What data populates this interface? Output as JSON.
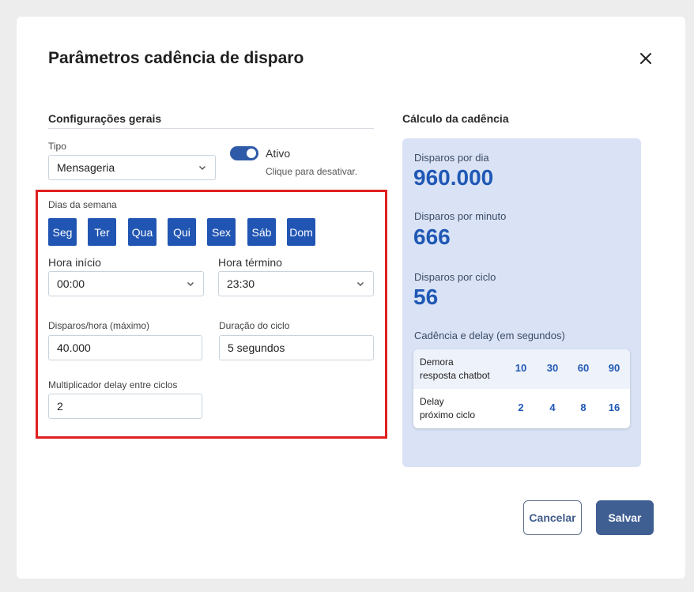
{
  "dialog": {
    "title": "Parâmetros cadência de disparo",
    "close_icon": "close-icon"
  },
  "general": {
    "heading": "Configurações gerais",
    "tipo_label": "Tipo",
    "tipo_value": "Mensageria",
    "toggle_label": "Ativo",
    "toggle_state": true,
    "toggle_hint": "Clique para desativar."
  },
  "schedule": {
    "days_label": "Dias da semana",
    "days": [
      "Seg",
      "Ter",
      "Qua",
      "Qui",
      "Sex",
      "Sáb",
      "Dom"
    ],
    "start_label": "Hora início",
    "start_value": "00:00",
    "end_label": "Hora término",
    "end_value": "23:30",
    "max_label": "Disparos/hora (máximo)",
    "max_value": "40.000",
    "cycle_label": "Duração do ciclo",
    "cycle_value": "5 segundos",
    "mult_label": "Multiplicador delay entre ciclos",
    "mult_value": "2"
  },
  "calc": {
    "heading": "Cálculo da cadência",
    "per_day_label": "Disparos por dia",
    "per_day_value": "960.000",
    "per_minute_label": "Disparos por minuto",
    "per_minute_value": "666",
    "per_cycle_label": "Disparos por ciclo",
    "per_cycle_value": "56",
    "table_label": "Cadência e delay (em segundos)",
    "rows": [
      {
        "line1": "Demora",
        "line2": "resposta chatbot",
        "values": [
          "10",
          "30",
          "60",
          "90"
        ]
      },
      {
        "line1": "Delay",
        "line2": "próximo ciclo",
        "values": [
          "2",
          "4",
          "8",
          "16"
        ]
      }
    ]
  },
  "actions": {
    "cancel": "Cancelar",
    "save": "Salvar"
  },
  "colors": {
    "accent": "#2155b3",
    "panel_bg": "#d9e3f5",
    "highlight_border": "#e02020",
    "save_button": "#3f5f93"
  }
}
